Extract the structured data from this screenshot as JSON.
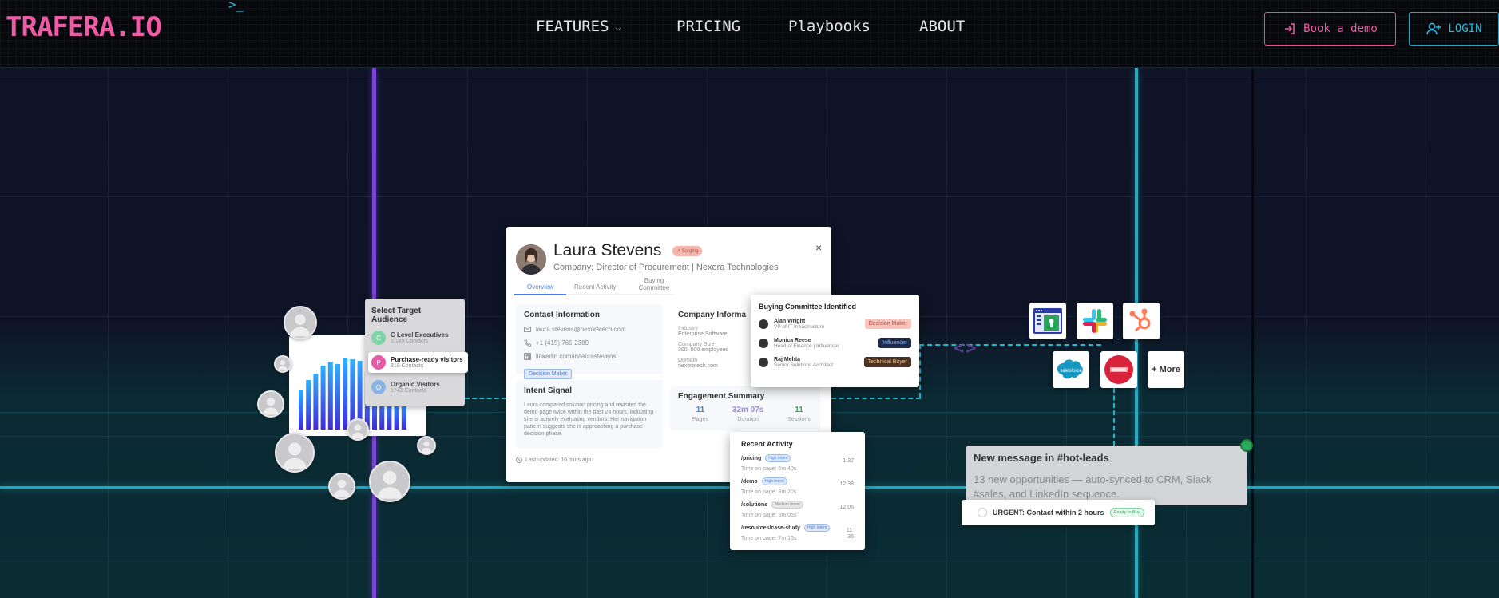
{
  "nav": {
    "logo": "TRAFERA.IO",
    "logo_prompt": ">_",
    "links": [
      "FEATURES",
      "PRICING",
      "Playbooks",
      "ABOUT"
    ],
    "book_demo": "Book a demo",
    "login": "LOGIN"
  },
  "audience": {
    "title": "Select Target Audience",
    "items": [
      {
        "initial": "C",
        "name": "C Level Executives",
        "sub": "3,145 Contacts"
      },
      {
        "initial": "P",
        "name": "Purchase-ready visitors",
        "sub": "819 Contacts"
      },
      {
        "initial": "O",
        "name": "Organic Visitors",
        "sub": "1742 Contacts"
      }
    ]
  },
  "profile": {
    "name": "Laura Stevens",
    "badge": "↗ Surging",
    "company": "Company: Director of Procurement | Nexora Technologies",
    "close": "×",
    "tabs": [
      "Overview",
      "Recent Activity",
      "Buying Committee"
    ],
    "contact": {
      "title": "Contact Information",
      "email": "laura.stevens@nexoratech.com",
      "phone": "+1 (415) 765-2389",
      "linkedin": "linkedin.com/in/laurastevens",
      "tag": "Decision Maker"
    },
    "company_info": {
      "title": "Company Informa",
      "industry_label": "Industry",
      "industry": "Enterprise Software",
      "size_label": "Company Size",
      "size": "300–500 employees",
      "domain_label": "Domain",
      "domain": "nexoratech.com"
    },
    "intent": {
      "title": "Intent Signal",
      "text": "Laura compared solution pricing and revisited the demo page twice within the past 24 hours, indicating she is actively evaluating vendors. Her navigation pattern suggests she is approaching a purchase decision phase."
    },
    "engagement": {
      "title": "Engagement Summary",
      "pages": "11",
      "pages_label": "Pages",
      "duration": "32m 07s",
      "duration_label": "Duration",
      "sessions": "11",
      "sessions_label": "Sessions"
    },
    "updated": "Last updated: 10 mins ago"
  },
  "committee": {
    "title": "Buying Committee Identified",
    "members": [
      {
        "name": "Alan Wright",
        "role": "VP of IT Infrastructure",
        "tag": "Decision Maker"
      },
      {
        "name": "Monica Reese",
        "role": "Head of Finance | Influencer",
        "tag": "Influencer"
      },
      {
        "name": "Raj Mehta",
        "role": "Senior Solutions Architect",
        "tag": "Technical Buyer"
      }
    ]
  },
  "activity": {
    "title": "Recent Activity",
    "items": [
      {
        "path": "/pricing",
        "tag": "High Intent",
        "time": "Time on page: 6m 40s",
        "ts": "1:32"
      },
      {
        "path": "/demo",
        "tag": "High Intent",
        "time": "Time on page: 8m 20s",
        "ts": "12:38"
      },
      {
        "path": "/solutions",
        "tag": "Medium Intent",
        "time": "Time on page: 5m 05s",
        "ts": "12:06"
      },
      {
        "path": "/resources/case-study",
        "tag": "High Intent",
        "time": "Time on page: 7m 10s",
        "ts": "11:36"
      }
    ]
  },
  "integrations": {
    "salesforce": "salesforce",
    "more": "+ More",
    "brackets": "<>"
  },
  "message": {
    "title": "New message in #hot-leads",
    "text": "13 new opportunities — auto-synced to CRM, Slack #sales, and LinkedIn sequence.",
    "urgent": "URGENT: Contact within 2 hours",
    "urgent_tag": "Ready to Buy"
  },
  "colors": {
    "brand_pink": "#ee5ca6",
    "brand_cyan": "#28c0e2",
    "accent_purple": "#7a44d6"
  },
  "chart_data": {
    "type": "bar",
    "values": [
      50,
      62,
      70,
      80,
      85,
      82,
      90,
      88,
      86,
      72,
      60,
      55,
      48,
      42,
      38
    ]
  }
}
